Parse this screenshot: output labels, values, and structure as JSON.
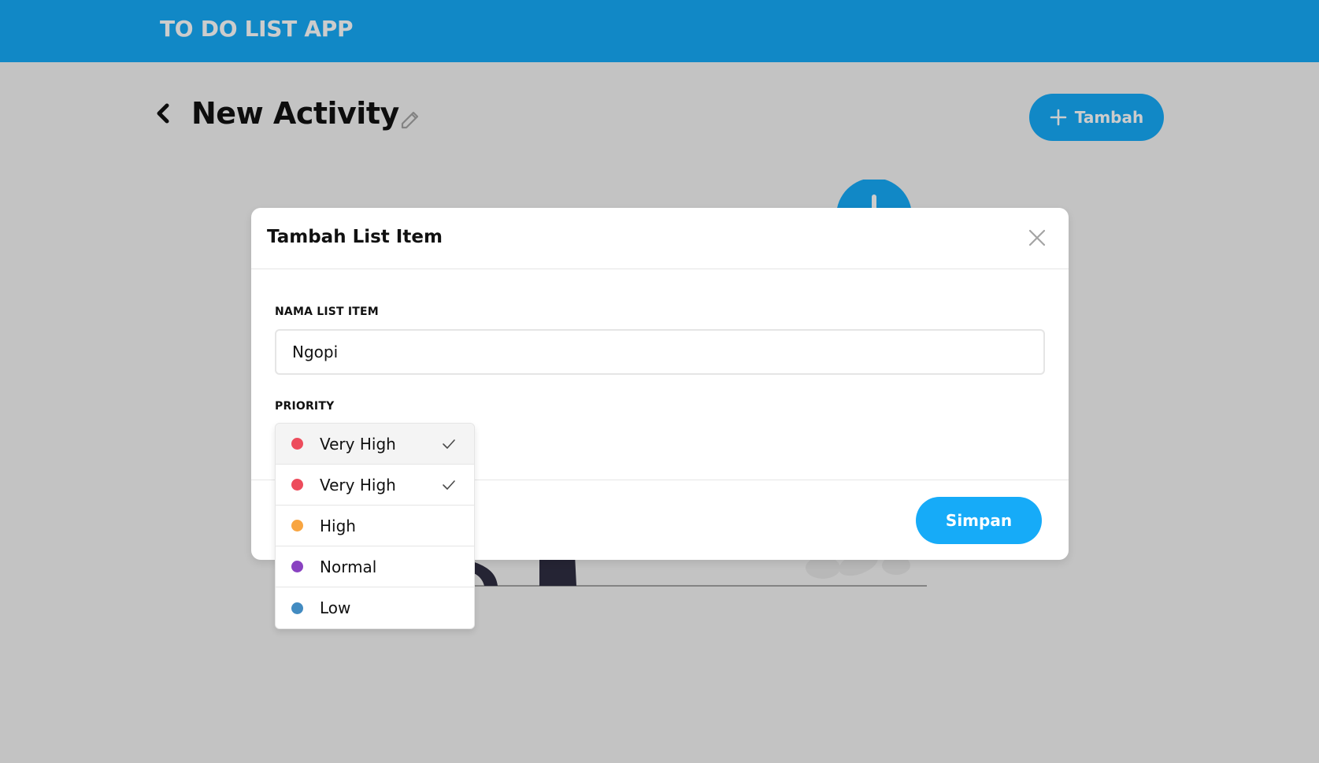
{
  "header": {
    "app_title": "TO DO LIST APP"
  },
  "activity": {
    "title": "New Activity",
    "add_button_label": "Tambah"
  },
  "modal": {
    "title": "Tambah List Item",
    "name_label": "NAMA LIST ITEM",
    "name_value": "Ngopi",
    "priority_label": "PRIORITY",
    "save_label": "Simpan"
  },
  "priority_dropdown": {
    "selected": {
      "label": "Very High",
      "color": "#ed4c5c"
    },
    "options": [
      {
        "label": "Very High",
        "color": "#ed4c5c",
        "checked": true
      },
      {
        "label": "High",
        "color": "#f8a541",
        "checked": false
      },
      {
        "label": "Normal",
        "color": "#8942c1",
        "checked": false
      },
      {
        "label": "Low",
        "color": "#428bc1",
        "checked": false
      }
    ]
  },
  "colors": {
    "accent": "#16abf8",
    "text": "#111111"
  },
  "icons": [
    "chevron-left-icon",
    "pencil-icon",
    "plus-icon",
    "close-icon",
    "check-icon"
  ]
}
